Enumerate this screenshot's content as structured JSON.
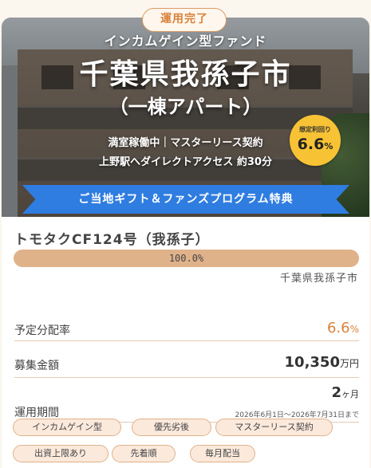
{
  "status_badge": "運用完了",
  "hero": {
    "subtitle": "インカムゲイン型ファンド",
    "title": "千葉県我孫子市",
    "title2": "（一棟アパート）",
    "line1": "満室稼働中｜マスターリース契約",
    "line2": "上野駅へダイレクトアクセス 約30分",
    "yield_label": "想定利回り",
    "yield_value": "6.6",
    "yield_unit": "%",
    "ribbon": "ご当地ギフト＆ファンズプログラム特典"
  },
  "fund": {
    "name": "トモタクCF124号（我孫子）",
    "progress_text": "100.0%",
    "progress_percent": 100,
    "location": "千葉県我孫子市"
  },
  "details": {
    "dist_label": "予定分配率",
    "dist_value": "6.6",
    "dist_unit": "%",
    "amount_label": "募集金額",
    "amount_value": "10,350",
    "amount_unit": "万円",
    "period_label": "運用期間",
    "period_value": "2",
    "period_unit": "ヶ月",
    "period_range": "2026年6月1日〜2026年7月31日まで"
  },
  "tags": [
    "インカムゲイン型",
    "優先劣後",
    "マスターリース契約",
    "出資上限あり",
    "先着順",
    "毎月配当"
  ],
  "colors": {
    "accent": "#d9823c",
    "ribbon": "#2f7de0",
    "yield_badge": "#f7c234",
    "progress": "#e0b28a"
  }
}
